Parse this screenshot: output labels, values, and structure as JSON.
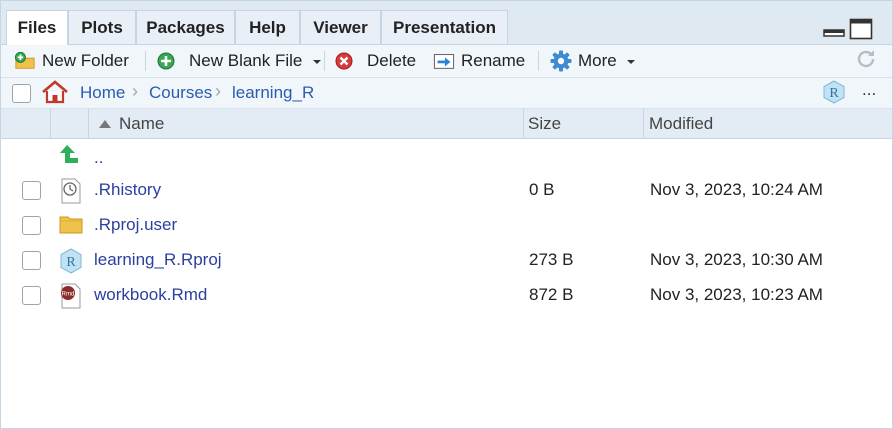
{
  "tabs": [
    {
      "label": "Files",
      "active": true
    },
    {
      "label": "Plots",
      "active": false
    },
    {
      "label": "Packages",
      "active": false
    },
    {
      "label": "Help",
      "active": false
    },
    {
      "label": "Viewer",
      "active": false
    },
    {
      "label": "Presentation",
      "active": false
    }
  ],
  "toolbar": {
    "new_folder": "New Folder",
    "new_blank_file": "New Blank File",
    "delete": "Delete",
    "rename": "Rename",
    "more": "More"
  },
  "breadcrumb": [
    "Home",
    "Courses",
    "learning_R"
  ],
  "pathbar_overflow": "...",
  "columns": {
    "name": "Name",
    "size": "Size",
    "modified": "Modified"
  },
  "parent_dir": "..",
  "files": [
    {
      "name": ".Rhistory",
      "size": "0 B",
      "modified": "Nov 3, 2023, 10:24 AM",
      "icon": "rhistory-icon"
    },
    {
      "name": ".Rproj.user",
      "size": "",
      "modified": "",
      "icon": "folder-icon"
    },
    {
      "name": "learning_R.Rproj",
      "size": "273 B",
      "modified": "Nov 3, 2023, 10:30 AM",
      "icon": "rproj-icon"
    },
    {
      "name": "workbook.Rmd",
      "size": "872 B",
      "modified": "Nov 3, 2023, 10:23 AM",
      "icon": "rmd-icon"
    }
  ],
  "colors": {
    "accent": "#2a5db0",
    "link": "#2a3fa0",
    "tab_bg": "#dfe9f2",
    "toolbar_bg": "#f1f6fa"
  }
}
